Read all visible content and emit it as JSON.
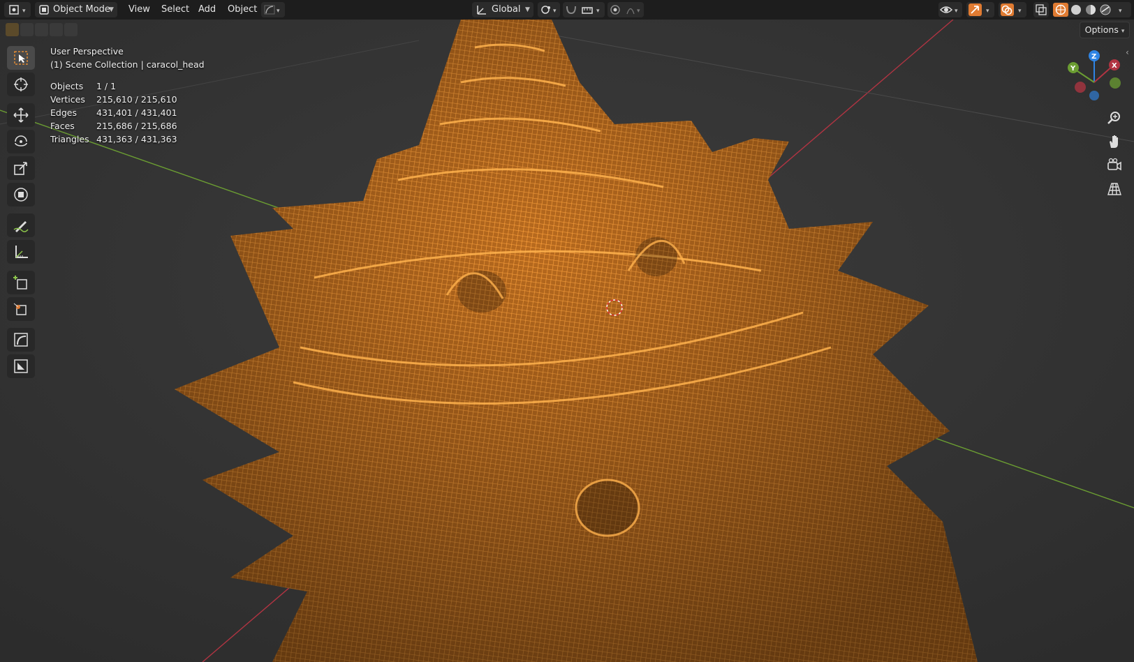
{
  "header": {
    "mode_label": "Object Mode",
    "menus": [
      "View",
      "Select",
      "Add",
      "Object"
    ],
    "orientation": "Global"
  },
  "options_label": "Options",
  "overlay": {
    "view_name": "User Perspective",
    "collection": "(1) Scene Collection | caracol_head"
  },
  "stats": [
    {
      "label": "Objects",
      "value": "1 / 1"
    },
    {
      "label": "Vertices",
      "value": "215,610 / 215,610"
    },
    {
      "label": "Edges",
      "value": "431,401 / 431,401"
    },
    {
      "label": "Faces",
      "value": "215,686 / 215,686"
    },
    {
      "label": "Triangles",
      "value": "431,363 / 431,363"
    }
  ],
  "gizmo": {
    "x": "X",
    "y": "Y",
    "z": "Z"
  },
  "colors": {
    "wire": "#ffa033",
    "axis_x": "#b13442",
    "axis_y": "#6b9d32",
    "gizmo_z": "#2f84e3"
  },
  "tools": [
    "select-box-icon",
    "cursor-icon",
    "move-icon",
    "rotate-icon",
    "scale-icon",
    "transform-icon",
    "annotate-icon",
    "measure-icon",
    "add-cube-icon",
    "transform-origin-icon",
    "shear-icon",
    "extrude-icon"
  ]
}
